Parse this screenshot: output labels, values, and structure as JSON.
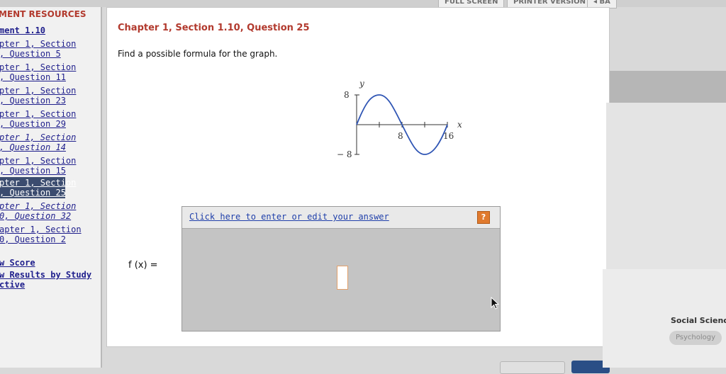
{
  "toolbar": {
    "full_screen": "FULL SCREEN",
    "printer_version": "PRINTER VERSION",
    "back": "◂ BA"
  },
  "sidebar": {
    "title": "MENT RESOURCES",
    "items": [
      {
        "label": "ment 1.10"
      },
      {
        "line1": "pter 1, Section",
        "line2": ", Question 5"
      },
      {
        "line1": "pter 1, Section",
        "line2": ", Question 11"
      },
      {
        "line1": "pter 1, Section",
        "line2": ", Question 23"
      },
      {
        "line1": "pter 1, Section",
        "line2": ", Question 29"
      },
      {
        "line1": "pter 1, Section",
        "line2": ", Question 14"
      },
      {
        "line1": "pter 1, Section",
        "line2": ", Question 15"
      },
      {
        "line1": "pter 1, Section",
        "line2": ", Question 25"
      },
      {
        "line1": "pter 1, Section",
        "line2": "0, Question 32"
      },
      {
        "line1": "apter 1, Section",
        "line2": "0, Question 2"
      }
    ],
    "score": "w Score",
    "results_line1": "w Results by Study",
    "results_line2": "ctive"
  },
  "question": {
    "title": "Chapter 1, Section 1.10, Question 25",
    "prompt": "Find a possible formula for the graph."
  },
  "graph": {
    "y_axis_label": "y",
    "x_axis_label": "x",
    "y_top_label": "8",
    "y_bottom_label": "− 8",
    "x_tick_8": "8",
    "x_tick_16": "16",
    "curve_color": "#2f55b4"
  },
  "answer": {
    "link_text": "Click here to enter or edit your answer",
    "help": "?",
    "function_label": "f (x) =",
    "value": ""
  },
  "right": {
    "social_science": "Social Science",
    "psychology": "Psychology"
  }
}
